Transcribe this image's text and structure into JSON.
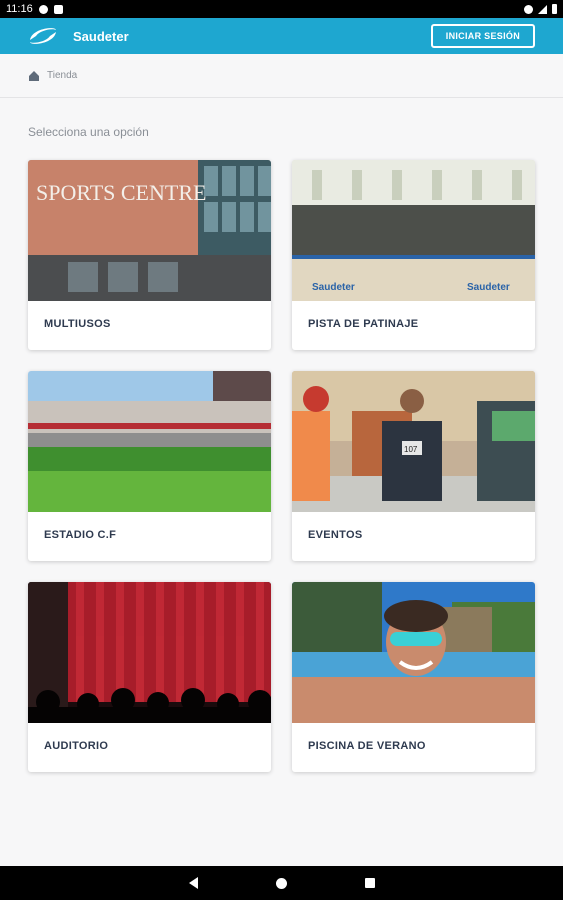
{
  "status_bar": {
    "time": "11:16"
  },
  "header": {
    "app_title": "Saudeter",
    "login_label": "INICIAR SESIÓN"
  },
  "breadcrumb": {
    "label": "Tienda"
  },
  "main": {
    "section_label": "Selecciona una opción",
    "options": [
      {
        "title": "MULTIUSOS",
        "image_text": "SPORTS CENTRE"
      },
      {
        "title": "PISTA DE PATINAJE",
        "image_text": "Saudeter"
      },
      {
        "title": "ESTADIO C.F"
      },
      {
        "title": "EVENTOS",
        "image_text": "107"
      },
      {
        "title": "AUDITORIO"
      },
      {
        "title": "PISCINA DE VERANO"
      }
    ]
  },
  "colors": {
    "brand": "#1ea7d0",
    "card_title": "#2e3a4f",
    "muted_text": "#8a8f96"
  },
  "icons": {
    "logo": "saudeter-logo",
    "home": "home-icon",
    "back": "back-icon",
    "nav_home": "nav-home-icon",
    "recents": "recents-icon"
  }
}
